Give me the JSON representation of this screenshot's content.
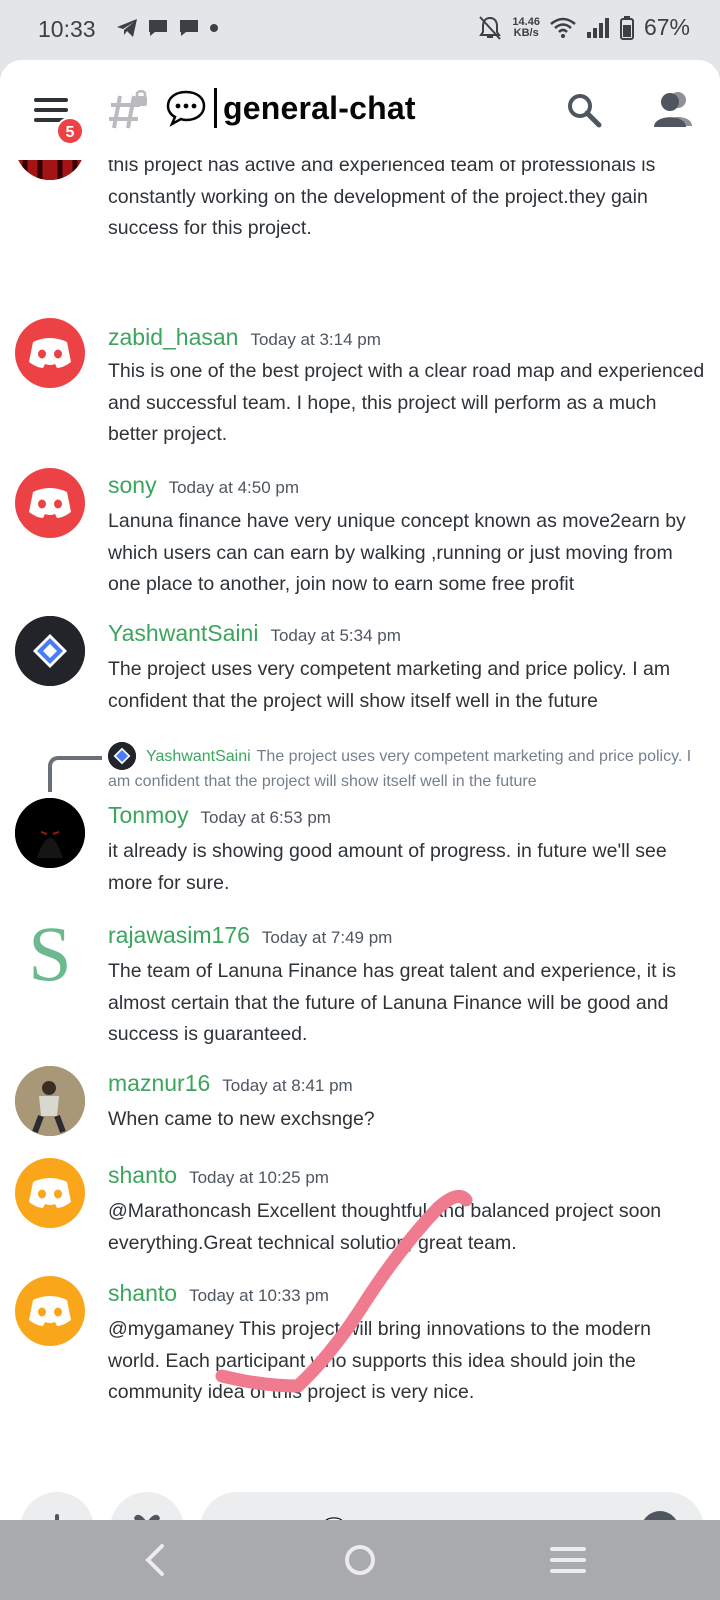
{
  "status_bar": {
    "time": "10:33",
    "net_speed_value": "14.46",
    "net_speed_unit": "KB/s",
    "battery": "67%"
  },
  "header": {
    "channel_title": "general-chat",
    "notification_badge": "5"
  },
  "messages": [
    {
      "username": "",
      "timestamp": "",
      "body": "this project has active and experienced team of professionals is constantly working on the development of the project.they gain success for this project.",
      "avatar": "red"
    },
    {
      "username": "zabid_hasan",
      "timestamp": "Today at 3:14 pm",
      "body": "This is one of the best project with a clear road map and experienced and successful team. I hope, this project will perform as a much better project.",
      "avatar": "discord-red"
    },
    {
      "username": "sony",
      "timestamp": "Today at 4:50 pm",
      "body": "Lanuna finance have very unique concept known as move2earn by which users can can earn by walking ,running or just moving from one place to another, join now to earn some free profit",
      "avatar": "discord-red"
    },
    {
      "username": "YashwantSaini",
      "timestamp": "Today at 5:34 pm",
      "body": "The project uses very competent marketing and price policy. I am confident that the project will show itself well in the future",
      "avatar": "diamond"
    },
    {
      "reply_to": {
        "username": "YashwantSaini",
        "text": "The project uses very competent marketing and price policy. I am confident that the project will show itself well in the future"
      },
      "username": "Tonmoy",
      "timestamp": "Today at 6:53 pm",
      "body": "it already is showing good amount of progress. in future we'll see more for sure.",
      "avatar": "dark"
    },
    {
      "username": "rajawasim176",
      "timestamp": "Today at 7:49 pm",
      "body": "The team of Lanuna Finance has great talent and experience, it is almost certain that the future of Lanuna Finance will be good and success is guaranteed.",
      "avatar": "letter-s"
    },
    {
      "username": "maznur16",
      "timestamp": "Today at 8:41 pm",
      "body": "When came to new exchsnge?",
      "avatar": "photo"
    },
    {
      "username": "shanto",
      "timestamp": "Today at 10:25 pm",
      "body": "@Marathoncash Excellent thoughtful and balanced project soon everything.Great technical solution, great team.",
      "avatar": "discord-orange"
    },
    {
      "username": "shanto",
      "timestamp": "Today at 10:33 pm",
      "body": "@mygamaney This project will bring innovations to the modern world. Each participant who supports this idea should join the community idea of this project is very nice.",
      "avatar": "discord-orange"
    }
  ],
  "input": {
    "placeholder": "Message #💬 | general-chat"
  },
  "colors": {
    "username_green": "#3ba55d",
    "discord_red": "#ed4245",
    "discord_orange": "#faa61a",
    "annotation_pink": "#f07a8e"
  },
  "icons": [
    "hamburger-menu-icon",
    "hash-lock-icon",
    "speech-bubble-icon",
    "search-icon",
    "members-icon",
    "plus-icon",
    "gift-icon",
    "emoji-icon",
    "back-icon",
    "home-icon",
    "recents-icon"
  ]
}
